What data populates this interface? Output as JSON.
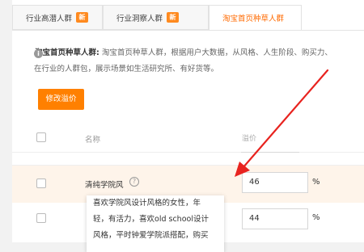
{
  "tabs": [
    {
      "label": "行业高潜人群",
      "badge": "新"
    },
    {
      "label": "行业洞察人群",
      "badge": "新"
    },
    {
      "label": "淘宝首页种草人群",
      "badge": ""
    }
  ],
  "description": {
    "title": "淘宝首页种草人群:",
    "line1_rest": "淘宝首页种草人群，根据用户大数据，从风格、人生阶段、购买力、",
    "line2": "在行业的人群包，展示场景如生活研究所、有好货等。"
  },
  "modify_button": "修改溢价",
  "table": {
    "header_name": "名称",
    "header_premium": "溢价",
    "rows": [
      {
        "name": "清纯学院风",
        "premium": "46",
        "unit": "%"
      },
      {
        "name": "",
        "premium": "44",
        "unit": "%"
      }
    ]
  },
  "tooltip": {
    "lines": [
      "喜欢学院风设计风格的女性，年",
      "轻，有活力，喜欢old school设计",
      "风格，平时钟爱学院派搭配，购买"
    ]
  },
  "colors": {
    "accent": "#ff6a00",
    "button": "#ff8000",
    "arrow": "#e8231f",
    "highlight_row": "#fef4ea"
  }
}
